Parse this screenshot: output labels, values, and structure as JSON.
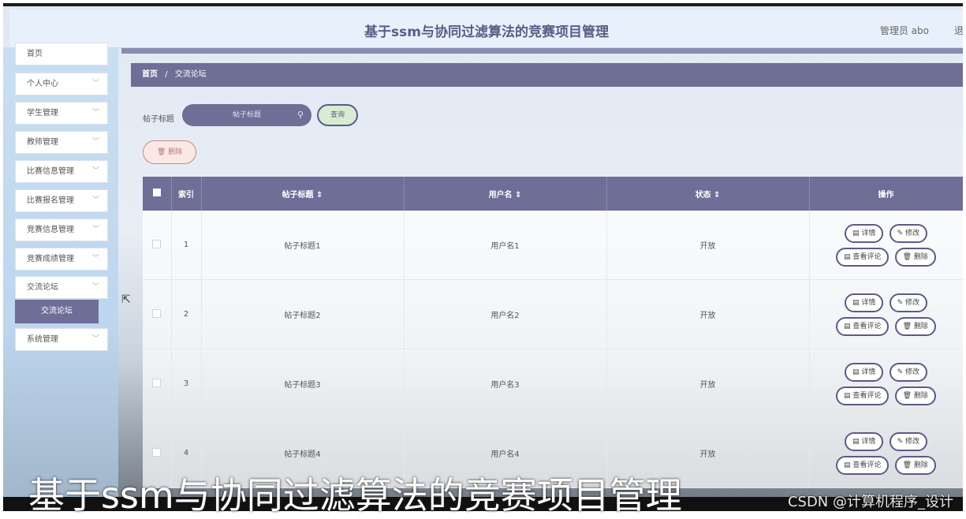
{
  "header": {
    "title": "基于ssm与协同过滤算法的竞赛项目管理",
    "user": "管理员 abo",
    "logout": "退"
  },
  "sidebar": {
    "items": [
      {
        "label": "首页"
      },
      {
        "label": "个人中心"
      },
      {
        "label": "学生管理"
      },
      {
        "label": "教师管理"
      },
      {
        "label": "比赛信息管理"
      },
      {
        "label": "比赛报名管理"
      },
      {
        "label": "竞赛信息管理"
      },
      {
        "label": "竞赛成绩管理"
      },
      {
        "label": "交流论坛"
      },
      {
        "label": "系统管理"
      }
    ],
    "active_sub": "交流论坛"
  },
  "breadcrumb": {
    "home": "首页",
    "sep": "/",
    "current": "交流论坛"
  },
  "search": {
    "label": "帖子标题",
    "placeholder": "帖子标题",
    "query_label": "查询",
    "delete_label": "删除"
  },
  "table": {
    "columns": [
      "索引",
      "帖子标题 ⇕",
      "用户名 ⇕",
      "状态 ⇕",
      "操作"
    ],
    "rows": [
      {
        "index": "1",
        "title": "帖子标题1",
        "user": "用户名1",
        "status": "开放"
      },
      {
        "index": "2",
        "title": "帖子标题2",
        "user": "用户名2",
        "status": "开放"
      },
      {
        "index": "3",
        "title": "帖子标题3",
        "user": "用户名3",
        "status": "开放"
      },
      {
        "index": "4",
        "title": "帖子标题4",
        "user": "用户名4",
        "status": "开放"
      }
    ],
    "actions": {
      "detail": "详情",
      "edit": "修改",
      "comments": "查看评论",
      "delete": "删除"
    }
  },
  "overlay": {
    "caption": "基于ssm与协同过滤算法的竞赛项目管理",
    "watermark": "CSDN @计算机程序_设计"
  },
  "icons": {
    "search": "search-icon",
    "delete": "trash-icon",
    "detail": "document-icon",
    "edit": "pencil-icon",
    "chevron": "chevron-down-icon"
  },
  "colors": {
    "accent": "#6e6e96",
    "header_bg": "#e8f1fb",
    "query_bg": "#d8ecd1",
    "delete_bg": "#fbe8e5"
  }
}
